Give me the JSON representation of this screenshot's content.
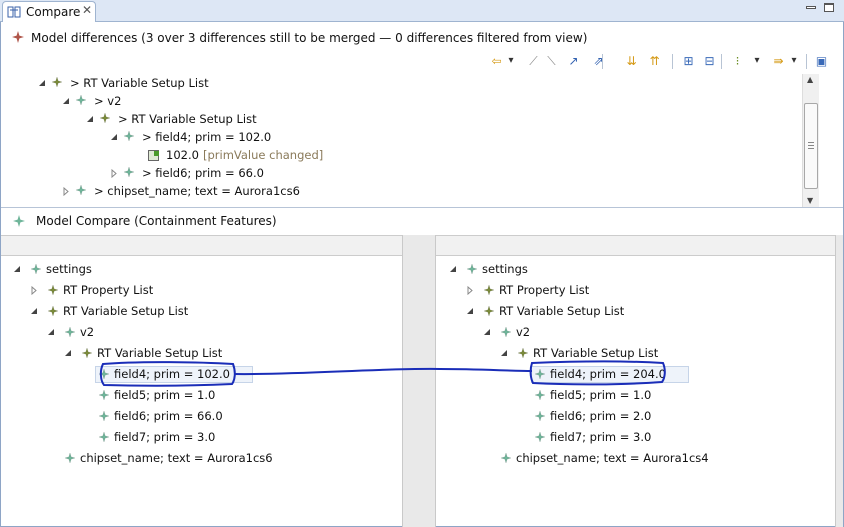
{
  "tab": {
    "title": "Compare",
    "close": "✕",
    "icon": "compare-editor-icon"
  },
  "window": {
    "minimize": "▭",
    "maximize": "▢"
  },
  "model_differences": {
    "title": "Model differences",
    "summary": "(3 over 3 differences still to be merged — 0 differences filtered from view)"
  },
  "toolbar": {
    "items": [
      {
        "icon": "arrow-left-icon",
        "glyph": "⇦",
        "color": "#d59a16"
      },
      {
        "icon": "dropdown-icon",
        "glyph": "▾",
        "color": "#333"
      },
      {
        "icon": "accept-change-icon",
        "glyph": "⟋",
        "color": "#8a8a8a"
      },
      {
        "icon": "reject-change-icon",
        "glyph": "⟍",
        "color": "#8a8a8a"
      },
      {
        "icon": "merge-right-icon",
        "glyph": "↗",
        "color": "#3060b0"
      },
      {
        "icon": "merge-all-right-icon",
        "glyph": "⇗",
        "color": "#3060b0"
      },
      {
        "icon": "next-difference-icon",
        "glyph": "⇊",
        "color": "#d59a16"
      },
      {
        "icon": "previous-difference-icon",
        "glyph": "⇈",
        "color": "#d59a16"
      },
      {
        "icon": "expand-all-icon",
        "glyph": "⊞",
        "color": "#3a6ab8"
      },
      {
        "icon": "collapse-all-icon",
        "glyph": "⊟",
        "color": "#3a6ab8"
      },
      {
        "icon": "group-icon",
        "glyph": "⁝",
        "color": "#6b8e23"
      },
      {
        "icon": "dropdown-icon",
        "glyph": "▾",
        "color": "#333"
      },
      {
        "icon": "filter-icon",
        "glyph": "⇛",
        "color": "#d59a16"
      },
      {
        "icon": "dropdown-icon",
        "glyph": "▾",
        "color": "#333"
      },
      {
        "icon": "save-icon",
        "glyph": "▣",
        "color": "#3a6ab8"
      }
    ]
  },
  "upper_tree": [
    {
      "text": "> RT Variable Setup List",
      "depth": 0,
      "twisty": "open"
    },
    {
      "text": "> v2",
      "depth": 1,
      "twisty": "open"
    },
    {
      "text": "> RT Variable Setup List",
      "depth": 2,
      "twisty": "open"
    },
    {
      "text": "> field4; prim = 102.0",
      "depth": 3,
      "twisty": "open",
      "selected": true
    },
    {
      "text": "102.0",
      "note": "[primValue changed]",
      "depth": 4,
      "twisty": "none",
      "attr": true
    },
    {
      "text": "> field6; prim = 66.0",
      "depth": 3,
      "twisty": "closed"
    },
    {
      "text": "> chipset_name; text = Aurora1cs6",
      "depth": 1,
      "twisty": "closed"
    }
  ],
  "compare": {
    "title": "Model Compare (Containment Features)"
  },
  "left_tree": [
    {
      "text": "settings",
      "depth": 0,
      "twisty": "open",
      "kind": "root"
    },
    {
      "text": "RT Property List",
      "depth": 1,
      "twisty": "closed"
    },
    {
      "text": "RT Variable Setup List",
      "depth": 1,
      "twisty": "open"
    },
    {
      "text": "v2",
      "depth": 2,
      "twisty": "open",
      "kind": "light"
    },
    {
      "text": "RT Variable Setup List",
      "depth": 3,
      "twisty": "open"
    },
    {
      "text": "field4; prim = 102.0",
      "depth": 4,
      "twisty": "none",
      "kind": "light",
      "highlight": true
    },
    {
      "text": "field5; prim = 1.0",
      "depth": 4,
      "twisty": "none",
      "kind": "light"
    },
    {
      "text": "field6; prim = 66.0",
      "depth": 4,
      "twisty": "none",
      "kind": "light"
    },
    {
      "text": "field7; prim = 3.0",
      "depth": 4,
      "twisty": "none",
      "kind": "light"
    },
    {
      "text": "chipset_name; text = Aurora1cs6",
      "depth": 2,
      "twisty": "none",
      "kind": "light"
    }
  ],
  "right_tree": [
    {
      "text": "settings",
      "depth": 0,
      "twisty": "open",
      "kind": "root"
    },
    {
      "text": "RT Property List",
      "depth": 1,
      "twisty": "closed"
    },
    {
      "text": "RT Variable Setup List",
      "depth": 1,
      "twisty": "open"
    },
    {
      "text": "v2",
      "depth": 2,
      "twisty": "open",
      "kind": "light"
    },
    {
      "text": "RT Variable Setup List",
      "depth": 3,
      "twisty": "open"
    },
    {
      "text": "field4; prim = 204.0",
      "depth": 4,
      "twisty": "none",
      "kind": "light",
      "highlight": true
    },
    {
      "text": "field5; prim = 1.0",
      "depth": 4,
      "twisty": "none",
      "kind": "light"
    },
    {
      "text": "field6; prim = 2.0",
      "depth": 4,
      "twisty": "none",
      "kind": "light"
    },
    {
      "text": "field7; prim = 3.0",
      "depth": 4,
      "twisty": "none",
      "kind": "light"
    },
    {
      "text": "chipset_name; text = Aurora1cs4",
      "depth": 2,
      "twisty": "none",
      "kind": "light"
    }
  ],
  "colors": {
    "diamond_dark": "#7a8a3a",
    "diamond_light": "#6fb59a",
    "note": "#8a7a5a",
    "annotation_ink": "#1a2db8"
  }
}
